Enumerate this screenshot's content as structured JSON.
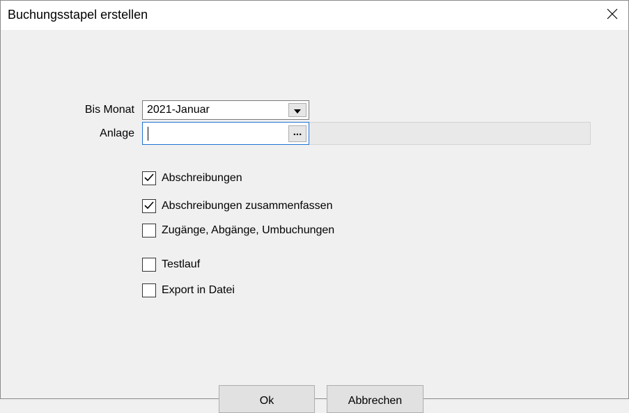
{
  "window": {
    "title": "Buchungsstapel erstellen"
  },
  "form": {
    "month_label": "Bis Monat",
    "month_value": "2021-Januar",
    "anlage_label": "Anlage",
    "anlage_value": "",
    "browse_label": "...",
    "anlage_display": ""
  },
  "options": [
    {
      "label": "Abschreibungen",
      "checked": true
    },
    {
      "label": "Abschreibungen zusammenfassen",
      "checked": true
    },
    {
      "label": "Zugänge, Abgänge, Umbuchungen",
      "checked": false
    },
    {
      "label": "Testlauf",
      "checked": false
    },
    {
      "label": "Export in Datei",
      "checked": false
    }
  ],
  "buttons": {
    "ok": "Ok",
    "cancel": "Abbrechen"
  }
}
